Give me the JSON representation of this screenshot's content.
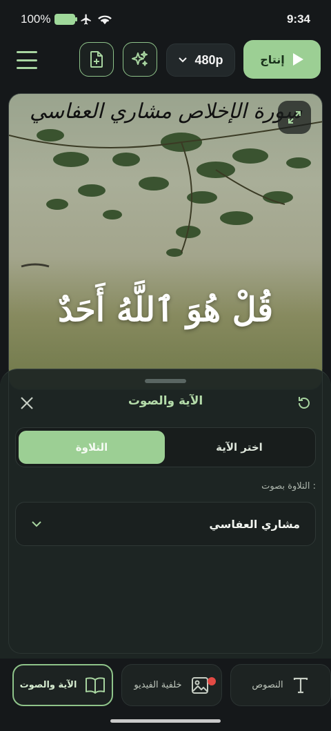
{
  "status_bar": {
    "battery": "100%",
    "time": "9:34"
  },
  "toolbar": {
    "resolution": "480p",
    "produce_label": "إنتاج"
  },
  "preview": {
    "surah_title": "سورة الإخلاص  مشاري العفاسي",
    "verse": "قُلْ هُوَ ٱللَّهُ أَحَدٌ"
  },
  "sheet": {
    "title": "الآية والصوت",
    "tabs": [
      {
        "label": "التلاوة",
        "active": true
      },
      {
        "label": "اختر الآية",
        "active": false
      }
    ],
    "reciter_label": "التلاوة بصوت :",
    "reciter_value": "مشاري العفاسي"
  },
  "bottom_nav": {
    "items": [
      {
        "label": "الآية والصوت",
        "icon": "book-icon",
        "active": true
      },
      {
        "label": "خلفية الفيديو",
        "icon": "image-icon",
        "active": false
      },
      {
        "label": "النصوص",
        "icon": "text-icon",
        "active": false
      }
    ]
  },
  "colors": {
    "accent": "#9ccf94",
    "background": "#15181a",
    "badge": "#e24a44"
  }
}
